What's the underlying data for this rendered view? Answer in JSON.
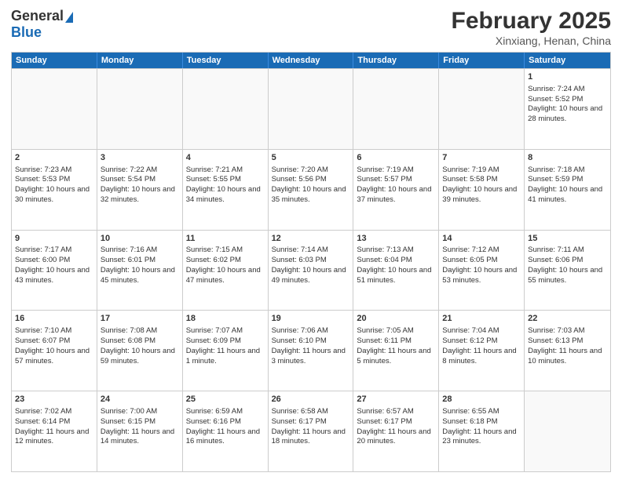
{
  "header": {
    "logo_general": "General",
    "logo_blue": "Blue",
    "month_title": "February 2025",
    "location": "Xinxiang, Henan, China"
  },
  "days_of_week": [
    "Sunday",
    "Monday",
    "Tuesday",
    "Wednesday",
    "Thursday",
    "Friday",
    "Saturday"
  ],
  "weeks": [
    [
      {
        "day": "",
        "empty": true
      },
      {
        "day": "",
        "empty": true
      },
      {
        "day": "",
        "empty": true
      },
      {
        "day": "",
        "empty": true
      },
      {
        "day": "",
        "empty": true
      },
      {
        "day": "",
        "empty": true
      },
      {
        "day": "1",
        "sunrise": "7:24 AM",
        "sunset": "5:52 PM",
        "daylight": "10 hours and 28 minutes."
      }
    ],
    [
      {
        "day": "2",
        "sunrise": "7:23 AM",
        "sunset": "5:53 PM",
        "daylight": "10 hours and 30 minutes."
      },
      {
        "day": "3",
        "sunrise": "7:22 AM",
        "sunset": "5:54 PM",
        "daylight": "10 hours and 32 minutes."
      },
      {
        "day": "4",
        "sunrise": "7:21 AM",
        "sunset": "5:55 PM",
        "daylight": "10 hours and 34 minutes."
      },
      {
        "day": "5",
        "sunrise": "7:20 AM",
        "sunset": "5:56 PM",
        "daylight": "10 hours and 35 minutes."
      },
      {
        "day": "6",
        "sunrise": "7:19 AM",
        "sunset": "5:57 PM",
        "daylight": "10 hours and 37 minutes."
      },
      {
        "day": "7",
        "sunrise": "7:19 AM",
        "sunset": "5:58 PM",
        "daylight": "10 hours and 39 minutes."
      },
      {
        "day": "8",
        "sunrise": "7:18 AM",
        "sunset": "5:59 PM",
        "daylight": "10 hours and 41 minutes."
      }
    ],
    [
      {
        "day": "9",
        "sunrise": "7:17 AM",
        "sunset": "6:00 PM",
        "daylight": "10 hours and 43 minutes."
      },
      {
        "day": "10",
        "sunrise": "7:16 AM",
        "sunset": "6:01 PM",
        "daylight": "10 hours and 45 minutes."
      },
      {
        "day": "11",
        "sunrise": "7:15 AM",
        "sunset": "6:02 PM",
        "daylight": "10 hours and 47 minutes."
      },
      {
        "day": "12",
        "sunrise": "7:14 AM",
        "sunset": "6:03 PM",
        "daylight": "10 hours and 49 minutes."
      },
      {
        "day": "13",
        "sunrise": "7:13 AM",
        "sunset": "6:04 PM",
        "daylight": "10 hours and 51 minutes."
      },
      {
        "day": "14",
        "sunrise": "7:12 AM",
        "sunset": "6:05 PM",
        "daylight": "10 hours and 53 minutes."
      },
      {
        "day": "15",
        "sunrise": "7:11 AM",
        "sunset": "6:06 PM",
        "daylight": "10 hours and 55 minutes."
      }
    ],
    [
      {
        "day": "16",
        "sunrise": "7:10 AM",
        "sunset": "6:07 PM",
        "daylight": "10 hours and 57 minutes."
      },
      {
        "day": "17",
        "sunrise": "7:08 AM",
        "sunset": "6:08 PM",
        "daylight": "10 hours and 59 minutes."
      },
      {
        "day": "18",
        "sunrise": "7:07 AM",
        "sunset": "6:09 PM",
        "daylight": "11 hours and 1 minute."
      },
      {
        "day": "19",
        "sunrise": "7:06 AM",
        "sunset": "6:10 PM",
        "daylight": "11 hours and 3 minutes."
      },
      {
        "day": "20",
        "sunrise": "7:05 AM",
        "sunset": "6:11 PM",
        "daylight": "11 hours and 5 minutes."
      },
      {
        "day": "21",
        "sunrise": "7:04 AM",
        "sunset": "6:12 PM",
        "daylight": "11 hours and 8 minutes."
      },
      {
        "day": "22",
        "sunrise": "7:03 AM",
        "sunset": "6:13 PM",
        "daylight": "11 hours and 10 minutes."
      }
    ],
    [
      {
        "day": "23",
        "sunrise": "7:02 AM",
        "sunset": "6:14 PM",
        "daylight": "11 hours and 12 minutes."
      },
      {
        "day": "24",
        "sunrise": "7:00 AM",
        "sunset": "6:15 PM",
        "daylight": "11 hours and 14 minutes."
      },
      {
        "day": "25",
        "sunrise": "6:59 AM",
        "sunset": "6:16 PM",
        "daylight": "11 hours and 16 minutes."
      },
      {
        "day": "26",
        "sunrise": "6:58 AM",
        "sunset": "6:17 PM",
        "daylight": "11 hours and 18 minutes."
      },
      {
        "day": "27",
        "sunrise": "6:57 AM",
        "sunset": "6:17 PM",
        "daylight": "11 hours and 20 minutes."
      },
      {
        "day": "28",
        "sunrise": "6:55 AM",
        "sunset": "6:18 PM",
        "daylight": "11 hours and 23 minutes."
      },
      {
        "day": "",
        "empty": true
      }
    ]
  ]
}
